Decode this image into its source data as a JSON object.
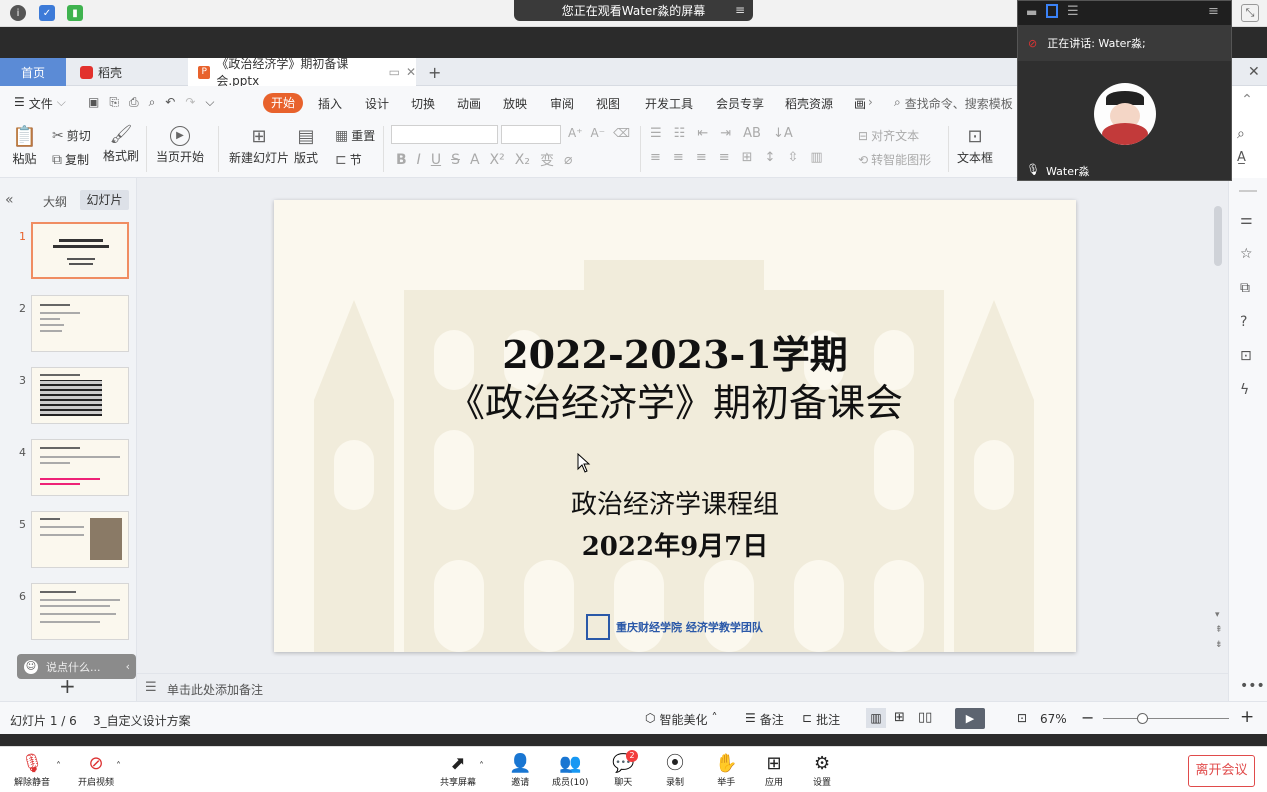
{
  "share_banner": {
    "text": "您正在观看Water淼的屏幕",
    "menu_icon": "≡"
  },
  "video": {
    "speaking_label": "正在讲话: Water淼;",
    "participant_name": "Water淼"
  },
  "wps_tabs": {
    "home": "首页",
    "docer": "稻壳",
    "file_tab": "《政治经济学》期初备课会.pptx",
    "add": "+"
  },
  "menu": {
    "file": "文件",
    "items": [
      "开始",
      "插入",
      "设计",
      "切换",
      "动画",
      "放映",
      "审阅",
      "视图",
      "开发工具",
      "会员专享",
      "稻壳资源",
      "画"
    ],
    "search": "查找命令、搜索模板"
  },
  "ribbon": {
    "paste": "粘贴",
    "cut": "剪切",
    "copy": "复制",
    "format_painter": "格式刷",
    "from_current": "当页开始",
    "new_slide": "新建幻灯片",
    "layout": "版式",
    "section": "节",
    "reset": "重置",
    "align_text": "对齐文本",
    "smart_shape": "转智能图形",
    "textbox": "文本框"
  },
  "left_panel": {
    "outline_tab": "大纲",
    "slides_tab": "幻灯片",
    "slide_numbers": [
      "1",
      "2",
      "3",
      "4",
      "5",
      "6"
    ],
    "chat_placeholder": "说点什么...",
    "add": "+"
  },
  "slide": {
    "title_line1": "2022-2023-1学期",
    "title_line2": "《政治经济学》期初备课会",
    "subtitle": "政治经济学课程组",
    "date": "2022年9月7日",
    "logo_text": "重庆财经学院 经济学教学团队"
  },
  "notes": {
    "placeholder": "单击此处添加备注"
  },
  "status": {
    "slide_count": "幻灯片 1 / 6",
    "theme": "3_自定义设计方案",
    "smart_beautify": "智能美化",
    "notes": "备注",
    "comments": "批注",
    "zoom": "67%"
  },
  "meeting": {
    "unmute": "解除静音",
    "start_video": "开启视频",
    "share_screen": "共享屏幕",
    "invite": "邀请",
    "members": "成员(10)",
    "chat": "聊天",
    "chat_badge": "2",
    "record": "录制",
    "raise_hand": "举手",
    "apps": "应用",
    "settings": "设置",
    "leave": "离开会议"
  },
  "colors": {
    "accent_orange": "#e8622c",
    "wps_blue": "#5b8bd6",
    "leave_red": "#e04b4b",
    "badge_red": "#f23c3c"
  }
}
